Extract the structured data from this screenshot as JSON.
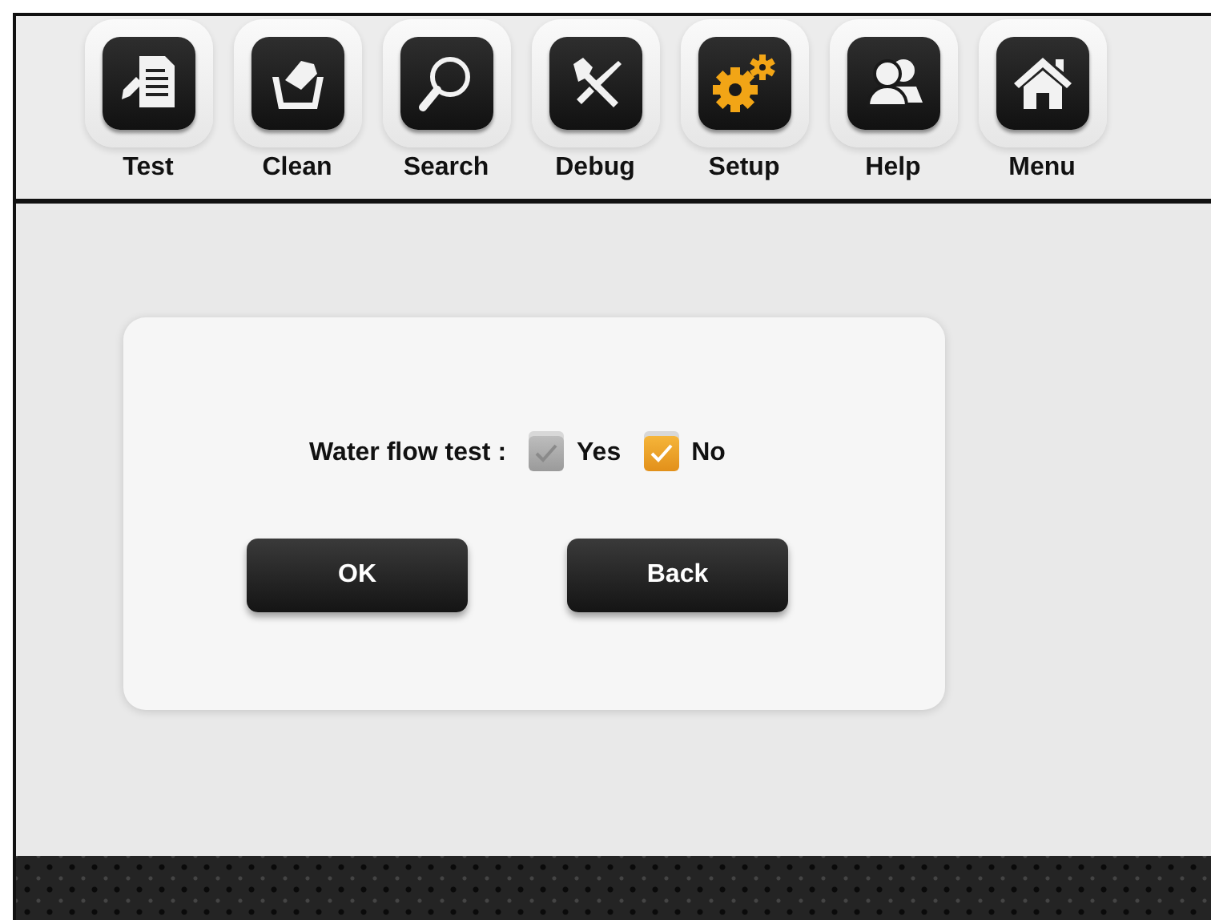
{
  "toolbar": [
    {
      "label": "Test",
      "selected": false
    },
    {
      "label": "Clean",
      "selected": false
    },
    {
      "label": "Search",
      "selected": false
    },
    {
      "label": "Debug",
      "selected": false
    },
    {
      "label": "Setup",
      "selected": true
    },
    {
      "label": "Help",
      "selected": false
    },
    {
      "label": "Menu",
      "selected": false
    }
  ],
  "dialog": {
    "label": "Water flow test :",
    "options": [
      {
        "label": "Yes",
        "checked": false
      },
      {
        "label": "No",
        "checked": true
      }
    ],
    "buttons": [
      "OK",
      "Back"
    ]
  }
}
